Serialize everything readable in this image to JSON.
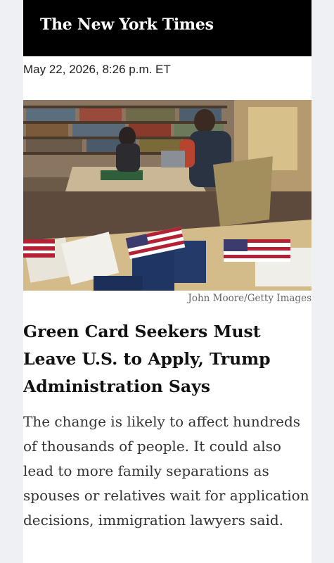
{
  "masthead": {
    "logo_text": "The New York Times"
  },
  "article": {
    "timestamp": "May 22, 2026, 8:26 p.m. ET",
    "image_credit": "John Moore/Getty Images",
    "headline": "Green Card Seekers Must Leave U.S. to Apply, Trump Administration Says",
    "summary": "The change is likely to affect hundreds of thousands of people. It could also lead to more family separations as spouses or relatives wait for application decisions, immigration lawyers said."
  },
  "colors": {
    "masthead_bg": "#000000",
    "logo": "#ffffff",
    "headline": "#111111",
    "summary": "#333333",
    "credit": "#666666"
  }
}
